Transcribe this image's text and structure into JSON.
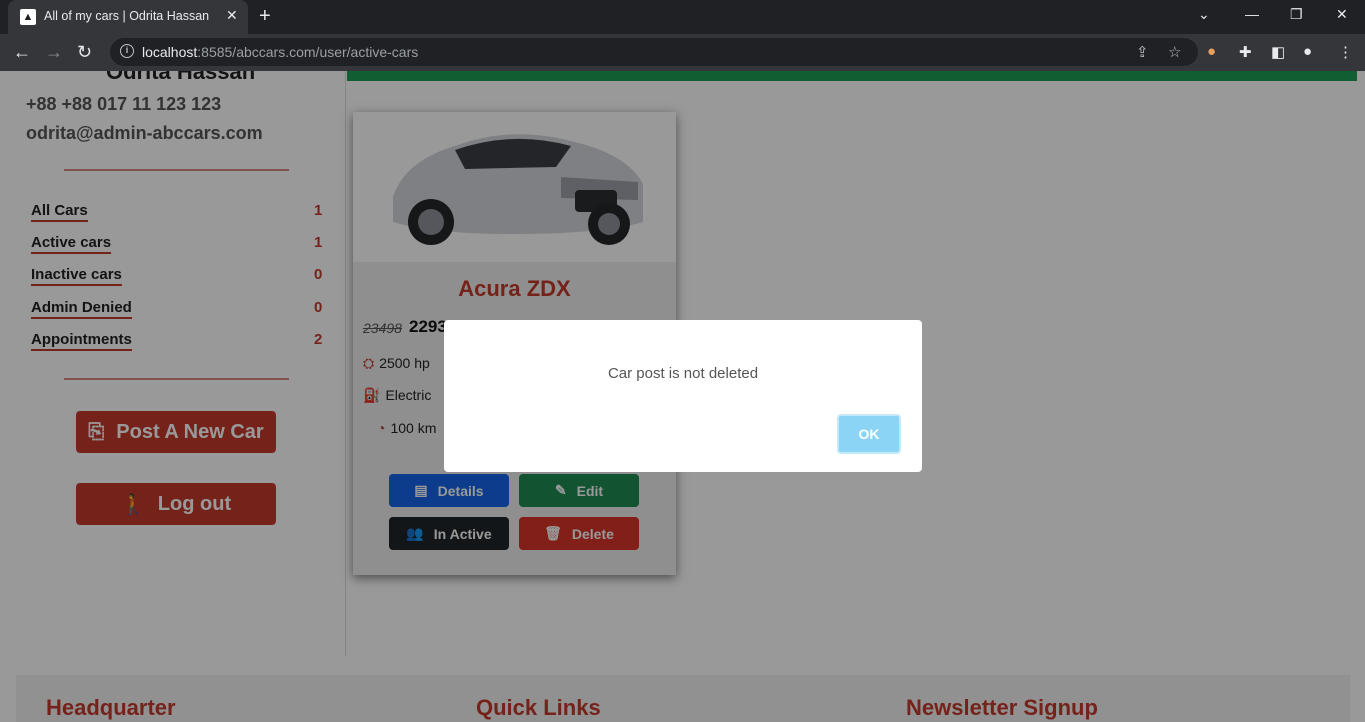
{
  "browser": {
    "tab_title": "All of my cars | Odrita Hassan",
    "url_host": "localhost",
    "url_rest": ":8585/abccars.com/user/active-cars"
  },
  "sidebar": {
    "owner_name": "Odrita Hassan",
    "phone": "+88 +88 017 11 123 123",
    "email": "odrita@admin-abccars.com",
    "links": [
      {
        "label": "All Cars",
        "count": "1"
      },
      {
        "label": "Active cars",
        "count": "1"
      },
      {
        "label": "Inactive cars",
        "count": "0"
      },
      {
        "label": "Admin Denied",
        "count": "0"
      },
      {
        "label": "Appointments",
        "count": "2"
      }
    ],
    "post_button": "Post A New Car",
    "logout_button": "Log out"
  },
  "card": {
    "title": "Acura ZDX",
    "price_old": "23498",
    "price_new": "2293",
    "power": "2500 hp",
    "fuel": "Electric",
    "mileage": "100 km",
    "btn_details": "Details",
    "btn_edit": "Edit",
    "btn_inactive": "In Active",
    "btn_delete": "Delete"
  },
  "footer": {
    "col1": "Headquarter",
    "col2": "Quick Links",
    "col3": "Newsletter Signup"
  },
  "dialog": {
    "message": "Car post is not deleted",
    "ok": "OK"
  },
  "colors": {
    "accent": "#c43a2e",
    "success": "#1f9d55",
    "primary": "#1565e8"
  }
}
